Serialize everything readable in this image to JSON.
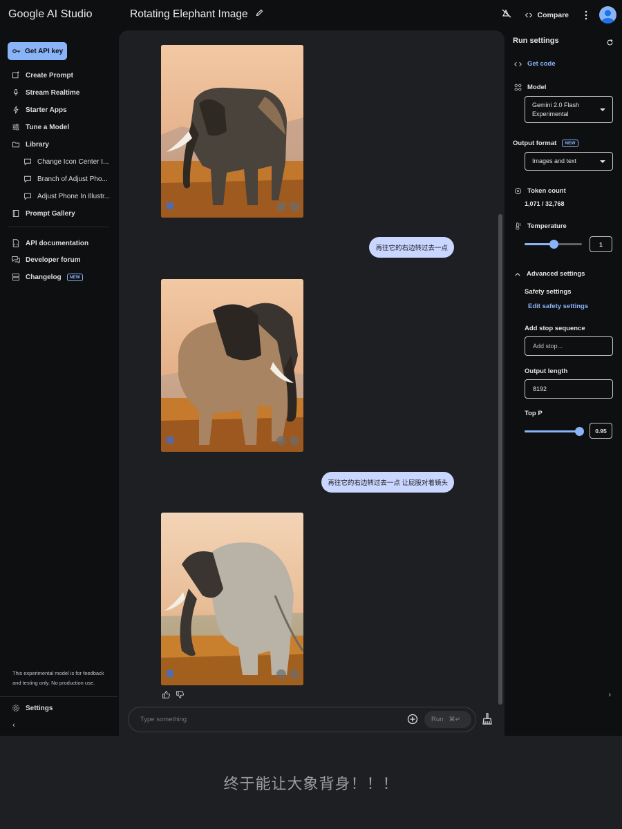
{
  "app": {
    "brand": "Google AI Studio",
    "doc_title": "Rotating Elephant Image",
    "compare_label": "Compare"
  },
  "sidebar": {
    "api_key_label": "Get API key",
    "items": [
      {
        "label": "Create Prompt",
        "icon": "create-prompt-icon"
      },
      {
        "label": "Stream Realtime",
        "icon": "microphone-icon"
      },
      {
        "label": "Starter Apps",
        "icon": "bolt-icon"
      },
      {
        "label": "Tune a Model",
        "icon": "sliders-icon"
      },
      {
        "label": "Library",
        "icon": "folder-icon"
      }
    ],
    "library_items": [
      {
        "label": "Change Icon Center I..."
      },
      {
        "label": "Branch of Adjust Pho..."
      },
      {
        "label": "Adjust Phone In Illustr..."
      }
    ],
    "prompt_gallery_label": "Prompt Gallery",
    "bottom_links": [
      {
        "label": "API documentation",
        "icon": "doc-icon"
      },
      {
        "label": "Developer forum",
        "icon": "forum-icon"
      },
      {
        "label": "Changelog",
        "icon": "changelog-icon",
        "badge": "NEW"
      }
    ],
    "disclaimer": "This experimental model is for feedback and testing only. No production use.",
    "settings_label": "Settings"
  },
  "chat": {
    "messages": [
      {
        "type": "image",
        "description_icon": "elephant-image"
      },
      {
        "type": "user",
        "text": "再往它的右边转过去一点"
      },
      {
        "type": "image",
        "description_icon": "elephant-image"
      },
      {
        "type": "user",
        "text": "再往它的右边转过去一点 让屁股对着镜头"
      },
      {
        "type": "image",
        "description_icon": "elephant-image"
      }
    ],
    "composer_placeholder": "Type something",
    "run_label": "Run",
    "run_shortcut": "⌘↵"
  },
  "run_settings": {
    "title": "Run settings",
    "get_code_label": "Get code",
    "model_label": "Model",
    "model_value": "Gemini 2.0 Flash Experimental",
    "output_format_label": "Output format",
    "output_format_badge": "NEW",
    "output_format_value": "Images and text",
    "token_count_label": "Token count",
    "token_count_value": "1,071 / 32,768",
    "temperature_label": "Temperature",
    "temperature_value": "1",
    "temperature_fraction": 0.5,
    "advanced_label": "Advanced settings",
    "safety_label": "Safety settings",
    "edit_safety_label": "Edit safety settings",
    "stop_sequence_label": "Add stop sequence",
    "stop_sequence_placeholder": "Add stop...",
    "output_length_label": "Output length",
    "output_length_value": "8192",
    "top_p_label": "Top P",
    "top_p_value": "0.95",
    "top_p_fraction": 0.95
  },
  "caption": "终于能让大象背身！！！",
  "colors": {
    "accent": "#8ab4f8",
    "user_bubble": "#c9d6ff",
    "app_bg": "#0e0f11",
    "chat_bg": "#1e1f22"
  }
}
